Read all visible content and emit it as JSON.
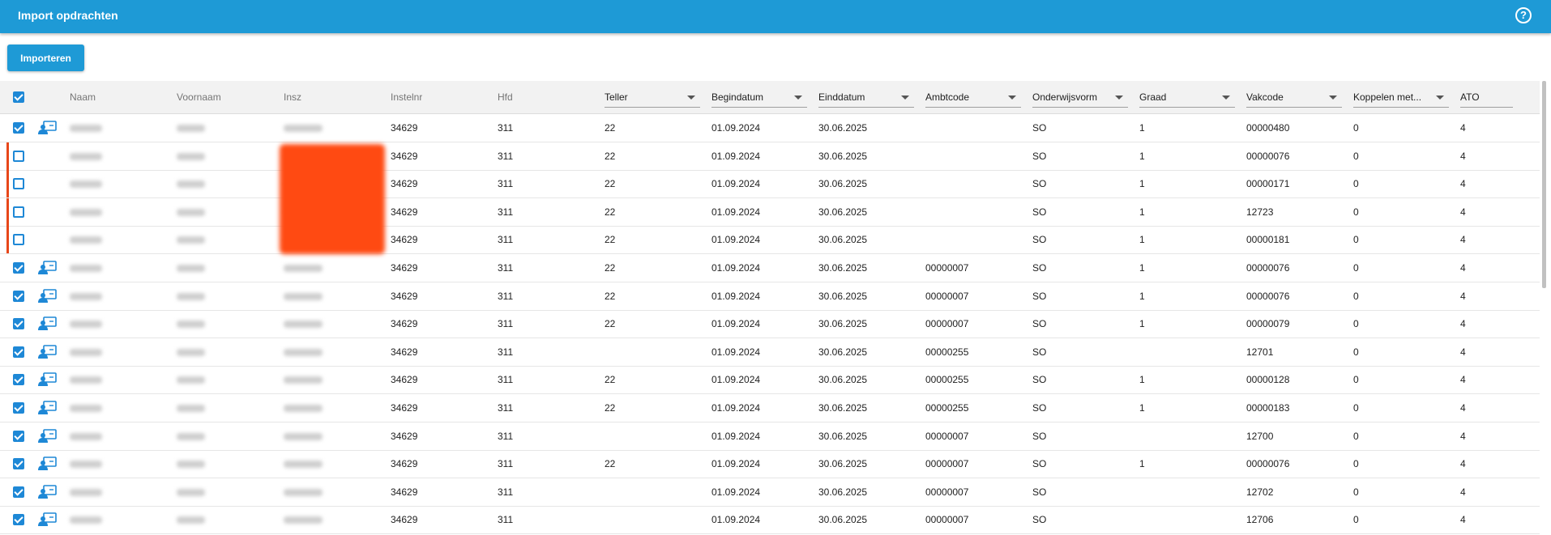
{
  "header": {
    "title": "Import opdrachten",
    "help_icon": "help-icon"
  },
  "toolbar": {
    "import_label": "Importeren"
  },
  "table": {
    "columns": {
      "naam": "Naam",
      "voornaam": "Voornaam",
      "insz": "Insz",
      "instelnr": "Instelnr",
      "hfd": "Hfd",
      "teller": "Teller",
      "begindatum": "Begindatum",
      "einddatum": "Einddatum",
      "ambtcode": "Ambtcode",
      "onderwijsvorm": "Onderwijsvorm",
      "graad": "Graad",
      "vakcode": "Vakcode",
      "koppelen": "Koppelen met...",
      "ato": "ATO"
    },
    "rows": [
      {
        "checked": true,
        "error": false,
        "instelnr": "34629",
        "hfd": "311",
        "teller": "22",
        "begindatum": "01.09.2024",
        "einddatum": "30.06.2025",
        "ambtcode": "",
        "onderwijsvorm": "SO",
        "graad": "1",
        "vakcode": "00000480",
        "koppelen": "0",
        "ato": "4"
      },
      {
        "checked": false,
        "error": true,
        "instelnr": "34629",
        "hfd": "311",
        "teller": "22",
        "begindatum": "01.09.2024",
        "einddatum": "30.06.2025",
        "ambtcode": "",
        "onderwijsvorm": "SO",
        "graad": "1",
        "vakcode": "00000076",
        "koppelen": "0",
        "ato": "4"
      },
      {
        "checked": false,
        "error": true,
        "instelnr": "34629",
        "hfd": "311",
        "teller": "22",
        "begindatum": "01.09.2024",
        "einddatum": "30.06.2025",
        "ambtcode": "",
        "onderwijsvorm": "SO",
        "graad": "1",
        "vakcode": "00000171",
        "koppelen": "0",
        "ato": "4"
      },
      {
        "checked": false,
        "error": true,
        "instelnr": "34629",
        "hfd": "311",
        "teller": "22",
        "begindatum": "01.09.2024",
        "einddatum": "30.06.2025",
        "ambtcode": "",
        "onderwijsvorm": "SO",
        "graad": "1",
        "vakcode": "12723",
        "koppelen": "0",
        "ato": "4"
      },
      {
        "checked": false,
        "error": true,
        "instelnr": "34629",
        "hfd": "311",
        "teller": "22",
        "begindatum": "01.09.2024",
        "einddatum": "30.06.2025",
        "ambtcode": "",
        "onderwijsvorm": "SO",
        "graad": "1",
        "vakcode": "00000181",
        "koppelen": "0",
        "ato": "4"
      },
      {
        "checked": true,
        "error": false,
        "instelnr": "34629",
        "hfd": "311",
        "teller": "22",
        "begindatum": "01.09.2024",
        "einddatum": "30.06.2025",
        "ambtcode": "00000007",
        "onderwijsvorm": "SO",
        "graad": "1",
        "vakcode": "00000076",
        "koppelen": "0",
        "ato": "4"
      },
      {
        "checked": true,
        "error": false,
        "instelnr": "34629",
        "hfd": "311",
        "teller": "22",
        "begindatum": "01.09.2024",
        "einddatum": "30.06.2025",
        "ambtcode": "00000007",
        "onderwijsvorm": "SO",
        "graad": "1",
        "vakcode": "00000076",
        "koppelen": "0",
        "ato": "4"
      },
      {
        "checked": true,
        "error": false,
        "instelnr": "34629",
        "hfd": "311",
        "teller": "22",
        "begindatum": "01.09.2024",
        "einddatum": "30.06.2025",
        "ambtcode": "00000007",
        "onderwijsvorm": "SO",
        "graad": "1",
        "vakcode": "00000079",
        "koppelen": "0",
        "ato": "4"
      },
      {
        "checked": true,
        "error": false,
        "instelnr": "34629",
        "hfd": "311",
        "teller": "",
        "begindatum": "01.09.2024",
        "einddatum": "30.06.2025",
        "ambtcode": "00000255",
        "onderwijsvorm": "SO",
        "graad": "",
        "vakcode": "12701",
        "koppelen": "0",
        "ato": "4"
      },
      {
        "checked": true,
        "error": false,
        "instelnr": "34629",
        "hfd": "311",
        "teller": "22",
        "begindatum": "01.09.2024",
        "einddatum": "30.06.2025",
        "ambtcode": "00000255",
        "onderwijsvorm": "SO",
        "graad": "1",
        "vakcode": "00000128",
        "koppelen": "0",
        "ato": "4"
      },
      {
        "checked": true,
        "error": false,
        "instelnr": "34629",
        "hfd": "311",
        "teller": "22",
        "begindatum": "01.09.2024",
        "einddatum": "30.06.2025",
        "ambtcode": "00000255",
        "onderwijsvorm": "SO",
        "graad": "1",
        "vakcode": "00000183",
        "koppelen": "0",
        "ato": "4"
      },
      {
        "checked": true,
        "error": false,
        "instelnr": "34629",
        "hfd": "311",
        "teller": "",
        "begindatum": "01.09.2024",
        "einddatum": "30.06.2025",
        "ambtcode": "00000007",
        "onderwijsvorm": "SO",
        "graad": "",
        "vakcode": "12700",
        "koppelen": "0",
        "ato": "4"
      },
      {
        "checked": true,
        "error": false,
        "instelnr": "34629",
        "hfd": "311",
        "teller": "22",
        "begindatum": "01.09.2024",
        "einddatum": "30.06.2025",
        "ambtcode": "00000007",
        "onderwijsvorm": "SO",
        "graad": "1",
        "vakcode": "00000076",
        "koppelen": "0",
        "ato": "4"
      },
      {
        "checked": true,
        "error": false,
        "instelnr": "34629",
        "hfd": "311",
        "teller": "",
        "begindatum": "01.09.2024",
        "einddatum": "30.06.2025",
        "ambtcode": "00000007",
        "onderwijsvorm": "SO",
        "graad": "",
        "vakcode": "12702",
        "koppelen": "0",
        "ato": "4"
      },
      {
        "checked": true,
        "error": false,
        "instelnr": "34629",
        "hfd": "311",
        "teller": "",
        "begindatum": "01.09.2024",
        "einddatum": "30.06.2025",
        "ambtcode": "00000007",
        "onderwijsvorm": "SO",
        "graad": "",
        "vakcode": "12706",
        "koppelen": "0",
        "ato": "4"
      }
    ]
  }
}
